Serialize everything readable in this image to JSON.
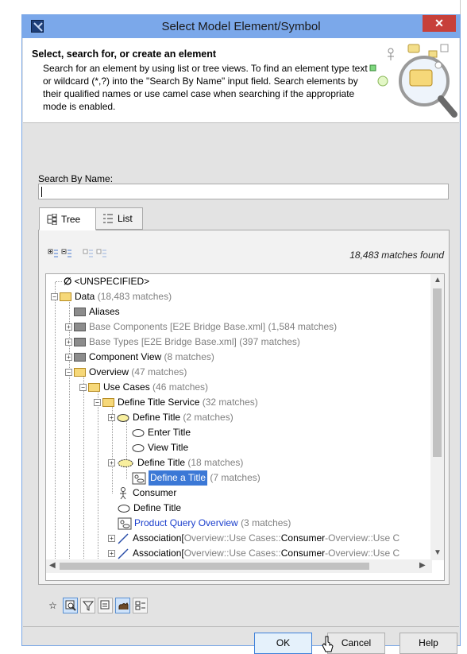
{
  "window": {
    "title": "Select Model Element/Symbol",
    "close_label": "✕"
  },
  "header": {
    "title": "Select, search for, or create an element",
    "description": "Search for an element by using list or tree views. To find an element type text or wildcard (*,?) into the \"Search By Name\" input field. Search elements by their qualified names or use camel case when searching if the appropriate mode is enabled."
  },
  "search": {
    "label": "Search By Name:",
    "value": ""
  },
  "tabs": [
    {
      "label": "Tree",
      "active": true
    },
    {
      "label": "List",
      "active": false
    }
  ],
  "results": {
    "matches_text": "18,483 matches found"
  },
  "tree": {
    "rows": [
      {
        "name": "<UNSPECIFIED>",
        "count": ""
      },
      {
        "name": "Data",
        "count": "(18,483 matches)"
      },
      {
        "name": "Aliases",
        "count": ""
      },
      {
        "name": "Base Components [E2E Bridge Base.xml]",
        "count": "(1,584 matches)"
      },
      {
        "name": "Base Types [E2E Bridge Base.xml]",
        "count": "(397 matches)"
      },
      {
        "name": "Component View",
        "count": "(8 matches)"
      },
      {
        "name": "Overview",
        "count": "(47 matches)"
      },
      {
        "name": "Use Cases",
        "count": "(46 matches)"
      },
      {
        "name": "Define Title Service",
        "count": "(32 matches)"
      },
      {
        "name": "Define Title",
        "count": "(2 matches)"
      },
      {
        "name": "Enter Title",
        "count": ""
      },
      {
        "name": "View Title",
        "count": ""
      },
      {
        "name": "Define Title",
        "count": "(18 matches)"
      },
      {
        "name": "Define a Title",
        "count": "(7 matches)"
      },
      {
        "name": "Consumer",
        "count": ""
      },
      {
        "name": "Define Title",
        "count": ""
      },
      {
        "name": "Product Query Overview",
        "count": "(3 matches)"
      },
      {
        "name": "Association",
        "bracket_open": "[",
        "path": "Overview::Use Cases::",
        "end": "Consumer",
        "dash": " - ",
        "path2": "Overview::Use C"
      },
      {
        "name": "Association",
        "bracket_open": "[",
        "path": "Overview::Use Cases::",
        "end": "Consumer",
        "dash": " - ",
        "path2": "Overview::Use C"
      }
    ]
  },
  "buttons": {
    "ok": "OK",
    "cancel": "Cancel",
    "help": "Help"
  },
  "colors": {
    "titlebar": "#7ba8ea",
    "close": "#c7403a",
    "selection": "#3b78d6",
    "link_blue": "#1a3ecc"
  }
}
